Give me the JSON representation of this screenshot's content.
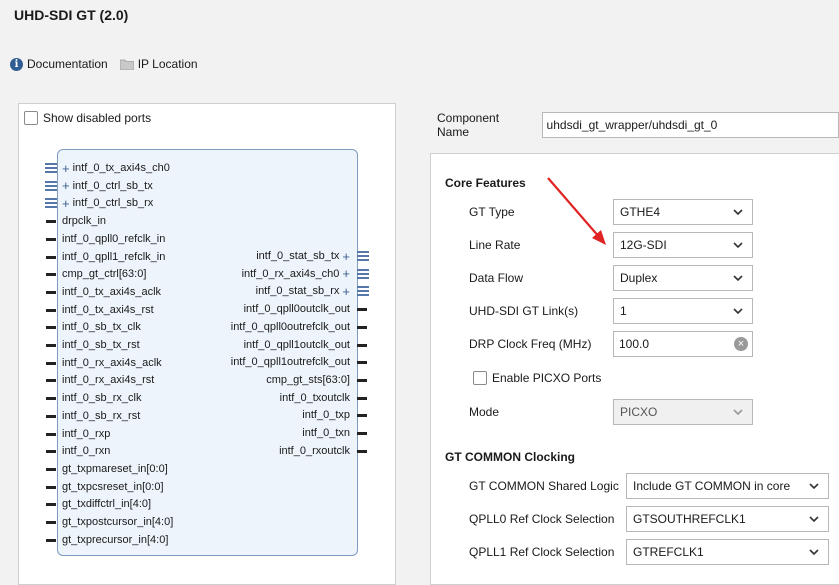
{
  "title": "UHD-SDI GT (2.0)",
  "toolbar": {
    "documentation": "Documentation",
    "ip_location": "IP Location"
  },
  "show_disabled": "Show disabled ports",
  "left_ports": [
    {
      "label": "intf_0_tx_axi4s_ch0",
      "type": "bus"
    },
    {
      "label": "intf_0_ctrl_sb_tx",
      "type": "bus"
    },
    {
      "label": "intf_0_ctrl_sb_rx",
      "type": "bus"
    },
    {
      "label": "drpclk_in",
      "type": "pin"
    },
    {
      "label": "intf_0_qpll0_refclk_in",
      "type": "pin"
    },
    {
      "label": "intf_0_qpll1_refclk_in",
      "type": "pin"
    },
    {
      "label": "cmp_gt_ctrl[63:0]",
      "type": "pin"
    },
    {
      "label": "intf_0_tx_axi4s_aclk",
      "type": "pin"
    },
    {
      "label": "intf_0_tx_axi4s_rst",
      "type": "pin"
    },
    {
      "label": "intf_0_sb_tx_clk",
      "type": "pin"
    },
    {
      "label": "intf_0_sb_tx_rst",
      "type": "pin"
    },
    {
      "label": "intf_0_rx_axi4s_aclk",
      "type": "pin"
    },
    {
      "label": "intf_0_rx_axi4s_rst",
      "type": "pin"
    },
    {
      "label": "intf_0_sb_rx_clk",
      "type": "pin"
    },
    {
      "label": "intf_0_sb_rx_rst",
      "type": "pin"
    },
    {
      "label": "intf_0_rxp",
      "type": "pin"
    },
    {
      "label": "intf_0_rxn",
      "type": "pin"
    },
    {
      "label": "gt_txpmareset_in[0:0]",
      "type": "pin"
    },
    {
      "label": "gt_txpcsreset_in[0:0]",
      "type": "pin"
    },
    {
      "label": "gt_txdiffctrl_in[4:0]",
      "type": "pin"
    },
    {
      "label": "gt_txpostcursor_in[4:0]",
      "type": "pin"
    },
    {
      "label": "gt_txprecursor_in[4:0]",
      "type": "pin"
    }
  ],
  "right_ports": [
    {
      "label": "intf_0_stat_sb_tx",
      "type": "bus"
    },
    {
      "label": "intf_0_rx_axi4s_ch0",
      "type": "bus"
    },
    {
      "label": "intf_0_stat_sb_rx",
      "type": "bus"
    },
    {
      "label": "intf_0_qpll0outclk_out",
      "type": "pin"
    },
    {
      "label": "intf_0_qpll0outrefclk_out",
      "type": "pin"
    },
    {
      "label": "intf_0_qpll1outclk_out",
      "type": "pin"
    },
    {
      "label": "intf_0_qpll1outrefclk_out",
      "type": "pin"
    },
    {
      "label": "cmp_gt_sts[63:0]",
      "type": "pin"
    },
    {
      "label": "intf_0_txoutclk",
      "type": "pin"
    },
    {
      "label": "intf_0_txp",
      "type": "pin"
    },
    {
      "label": "intf_0_txn",
      "type": "pin"
    },
    {
      "label": "intf_0_rxoutclk",
      "type": "pin"
    }
  ],
  "component": {
    "label": "Component Name",
    "value": "uhdsdi_gt_wrapper/uhdsdi_gt_0"
  },
  "core_features": {
    "heading": "Core Features",
    "gt_type": {
      "label": "GT Type",
      "value": "GTHE4"
    },
    "line_rate": {
      "label": "Line Rate",
      "value": "12G-SDI"
    },
    "data_flow": {
      "label": "Data Flow",
      "value": "Duplex"
    },
    "links": {
      "label": "UHD-SDI GT Link(s)",
      "value": "1"
    },
    "drp": {
      "label": "DRP Clock Freq (MHz)",
      "value": "100.0"
    },
    "picxo": {
      "label": "Enable PICXO Ports"
    },
    "mode": {
      "label": "Mode",
      "value": "PICXO"
    }
  },
  "gt_common": {
    "heading": "GT COMMON Clocking",
    "shared": {
      "label": "GT COMMON Shared Logic",
      "value": "Include GT COMMON in core"
    },
    "qpll0": {
      "label": "QPLL0 Ref Clock Selection",
      "value": "GTSOUTHREFCLK1"
    },
    "qpll1": {
      "label": "QPLL1 Ref Clock Selection",
      "value": "GTREFCLK1"
    }
  },
  "colors": {
    "arrow": "#e02424",
    "block_fill": "#edf4fb",
    "block_border": "#7e9cbf"
  }
}
